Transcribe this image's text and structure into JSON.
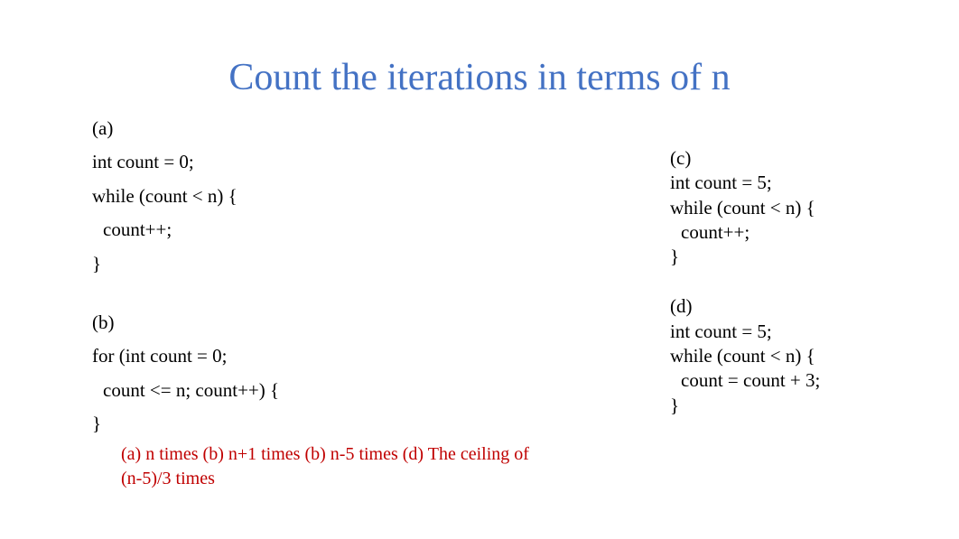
{
  "title": "Count the iterations in terms of n",
  "blocks": {
    "a": {
      "label": "(a)",
      "lines": [
        "int count = 0;",
        "while (count < n) {",
        "  count++;",
        "}"
      ]
    },
    "b": {
      "label": "(b)",
      "lines": [
        "for (int count = 0;",
        "  count <= n; count++) {",
        "}"
      ]
    },
    "c": {
      "label": "(c)",
      "lines": [
        "int count = 5;",
        "while (count < n) {",
        "  count++;",
        "}"
      ]
    },
    "d": {
      "label": "(d)",
      "lines": [
        "int count = 5;",
        "while (count < n) {",
        "  count = count + 3;",
        "}"
      ]
    }
  },
  "answer": "(a) n times (b) n+1 times (b) n-5 times (d) The ceiling of (n-5)/3 times"
}
